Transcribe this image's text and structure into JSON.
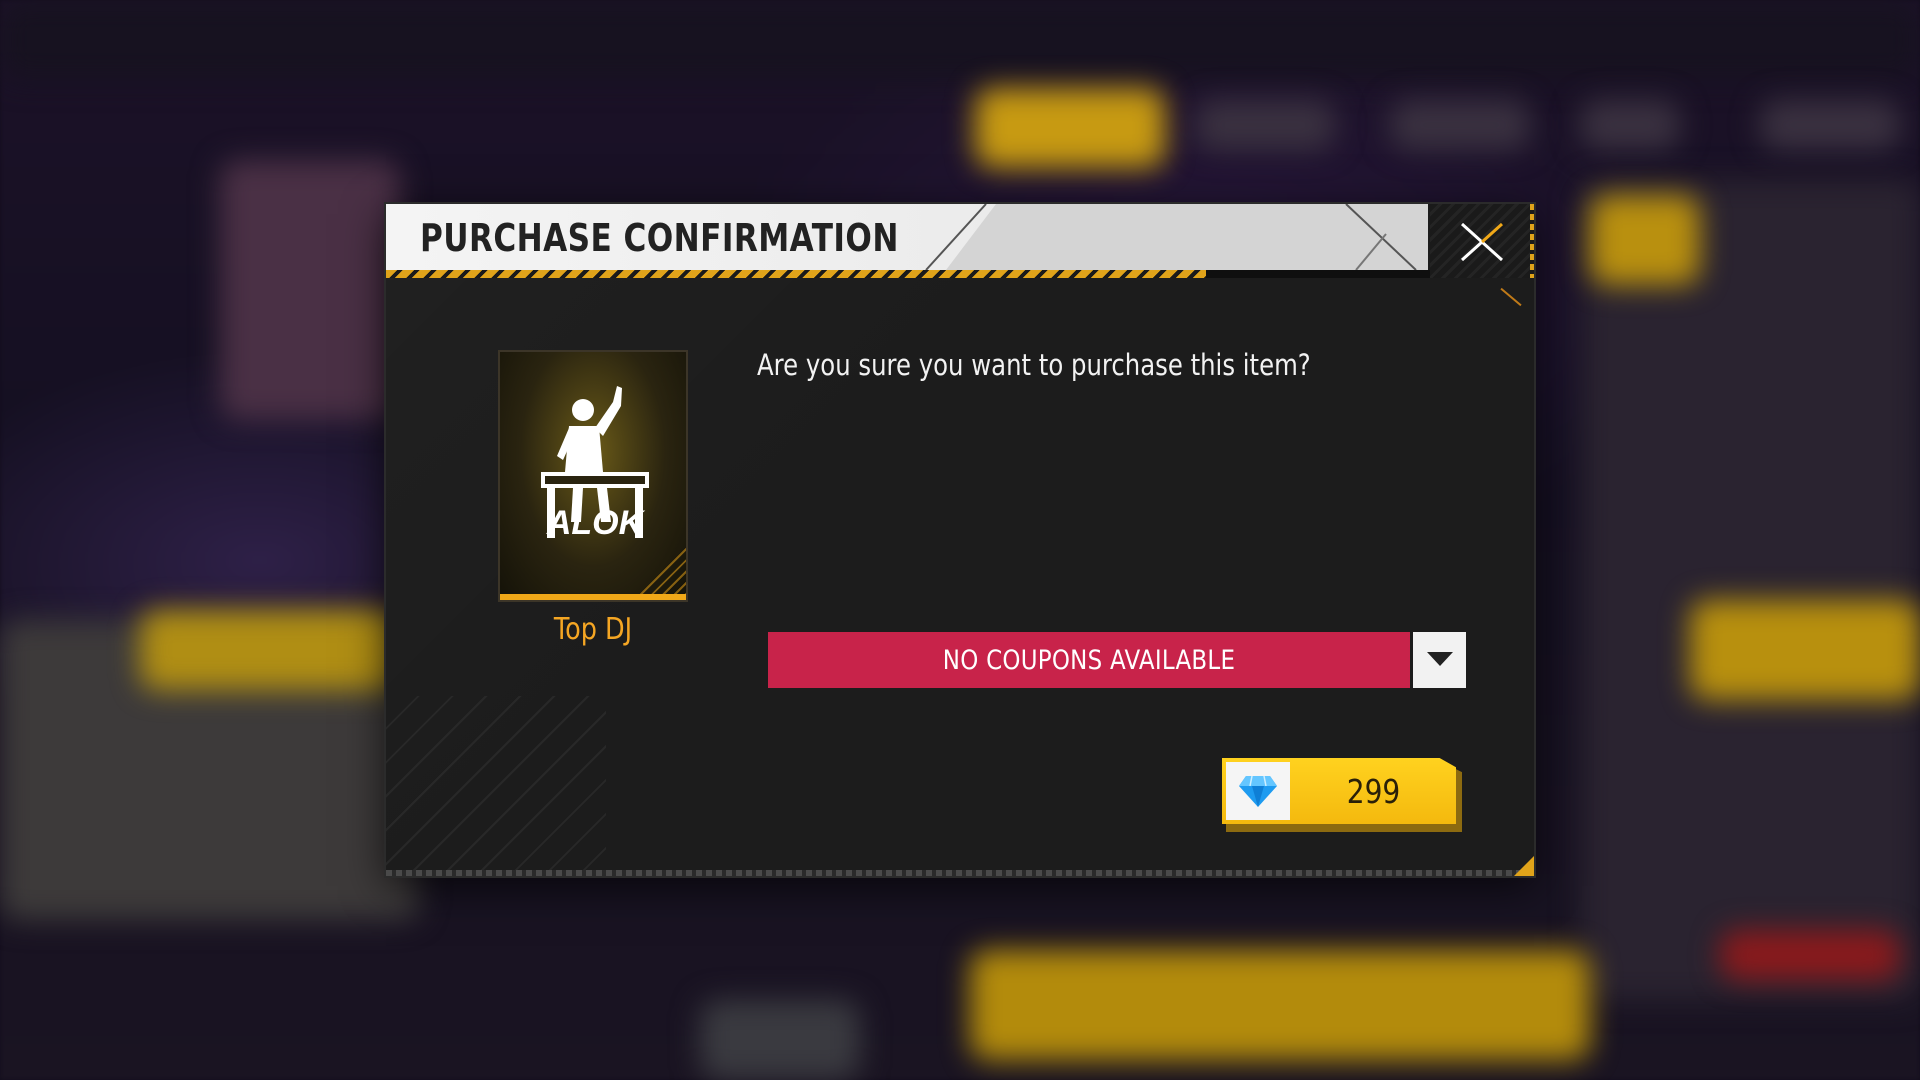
{
  "dialog": {
    "title": "PURCHASE CONFIRMATION",
    "close_icon": "close-icon"
  },
  "item": {
    "name": "Top DJ",
    "brand_text": "ALOK",
    "icon": "dj-emote-icon"
  },
  "question": "Are you sure you want to purchase this item?",
  "coupon": {
    "label": "NO COUPONS AVAILABLE",
    "arrow_icon": "chevron-down-icon"
  },
  "purchase": {
    "price": "299",
    "currency_icon": "diamond-icon"
  },
  "colors": {
    "accent": "#f5a623",
    "coupon_bg": "#c8234a",
    "price_bg": "#ffd21f"
  }
}
